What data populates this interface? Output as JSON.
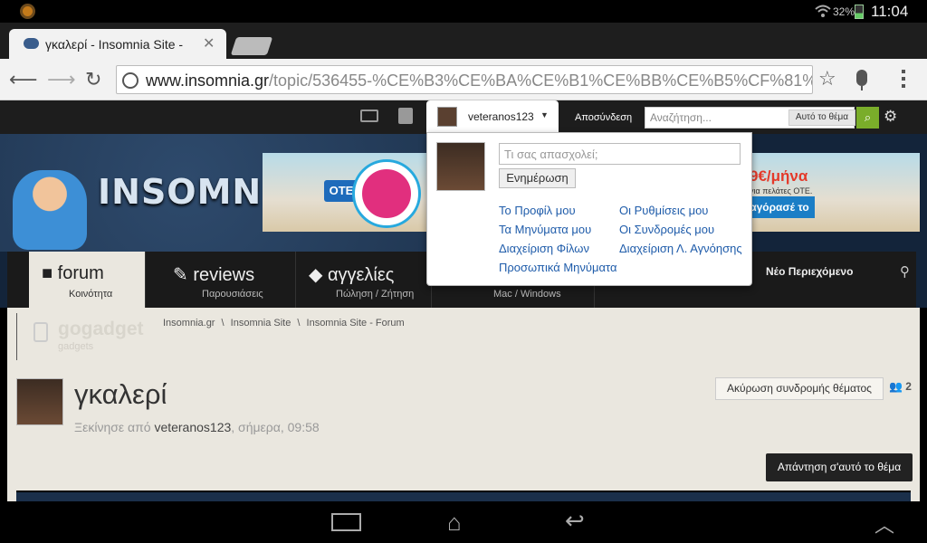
{
  "status_bar": {
    "battery": "32%",
    "time": "11:04"
  },
  "browser": {
    "tab_title": "γκαλερί - Insomnia Site -",
    "url_domain": "www.insomnia.gr",
    "url_path": "/topic/536455-%CE%B3%CE%BA%CE%B1%CE%BB%CE%B5%CF%81%CE%AF"
  },
  "site_bar": {
    "username": "veteranos123",
    "logout": "Αποσύνδεση",
    "search_placeholder": "Αναζήτηση...",
    "search_scope": "Αυτό το θέμα"
  },
  "banner": {
    "logo": "INSOMNIA",
    "ad": {
      "brand": "OTE",
      "price": "9€/μήνα",
      "sub": "για πελάτες ΟΤΕ.",
      "cta": "αγόρασέ το"
    }
  },
  "nav": {
    "items": [
      {
        "title": "forum",
        "subtitle": "Κοινότητα"
      },
      {
        "title": "reviews",
        "subtitle": "Παρουσιάσεις"
      },
      {
        "title": "αγγελίες",
        "subtitle": "Πώληση / Ζήτηση"
      },
      {
        "title": "",
        "subtitle": "Mac / Windows"
      }
    ],
    "new_content": "Νέο Περιεχόμενο"
  },
  "content": {
    "gogadget": {
      "title": "gogadget",
      "subtitle": "gadgets"
    },
    "breadcrumbs": [
      "Insomnia.gr",
      "\\",
      "Insomnia Site",
      "\\",
      "Insomnia Site - Forum"
    ],
    "topic_title": "γκαλερί",
    "meta_prefix": "Ξεκίνησε από",
    "author": "veteranos123",
    "meta_time": ", σήμερα, 09:58",
    "unsubscribe": "Ακύρωση συνδρομής θέματος",
    "followers": "2",
    "reply_button": "Απάντηση σ'αυτό το θέμα"
  },
  "popup": {
    "status_placeholder": "Τι σας απασχολεί;",
    "update_button": "Ενημέρωση",
    "links": [
      "Το Προφίλ μου",
      "Οι Ρυθμίσεις μου",
      "Τα Μηνύματα μου",
      "Οι Συνδρομές μου",
      "Διαχείριση Φίλων",
      "Διαχείριση Λ. Αγνόησης",
      "Προσωπικά Μηνύματα"
    ]
  }
}
